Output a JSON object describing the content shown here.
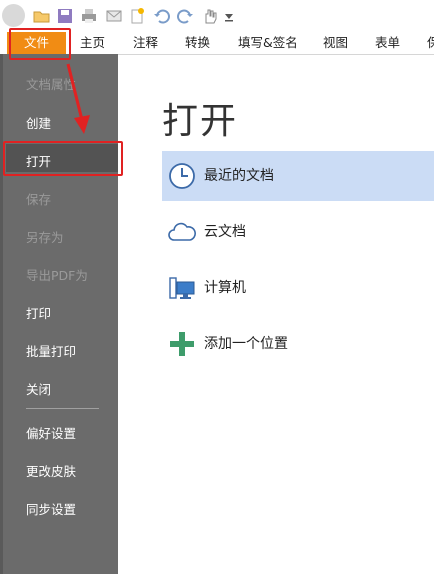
{
  "toolbar": {
    "icons": [
      "app-logo",
      "open-folder-icon",
      "save-icon",
      "print-icon",
      "email-icon",
      "new-icon",
      "undo-icon",
      "redo-icon",
      "hand-tool-icon",
      "customize-icon"
    ]
  },
  "tabs": [
    {
      "label": "文件"
    },
    {
      "label": "主页"
    },
    {
      "label": "注释"
    },
    {
      "label": "转换"
    },
    {
      "label": "填写&签名"
    },
    {
      "label": "视图"
    },
    {
      "label": "表单"
    },
    {
      "label": "保"
    }
  ],
  "sidebar": {
    "items": [
      {
        "label": "文档属性"
      },
      {
        "label": "创建"
      },
      {
        "label": "打开"
      },
      {
        "label": "保存"
      },
      {
        "label": "另存为"
      },
      {
        "label": "导出PDF为"
      },
      {
        "label": "打印"
      },
      {
        "label": "批量打印"
      },
      {
        "label": "关闭"
      },
      {
        "label": "偏好设置"
      },
      {
        "label": "更改皮肤"
      },
      {
        "label": "同步设置"
      }
    ]
  },
  "main": {
    "title": "打开",
    "locations": [
      {
        "label": "最近的文档",
        "icon": "clock-icon"
      },
      {
        "label": "云文档",
        "icon": "cloud-icon"
      },
      {
        "label": "计算机",
        "icon": "computer-icon"
      },
      {
        "label": "添加一个位置",
        "icon": "plus-icon"
      }
    ]
  },
  "colors": {
    "accent": "#f18c14",
    "sidebar": "#6b6b6b",
    "selection": "#cbdcf5",
    "annotation": "#e02222"
  }
}
